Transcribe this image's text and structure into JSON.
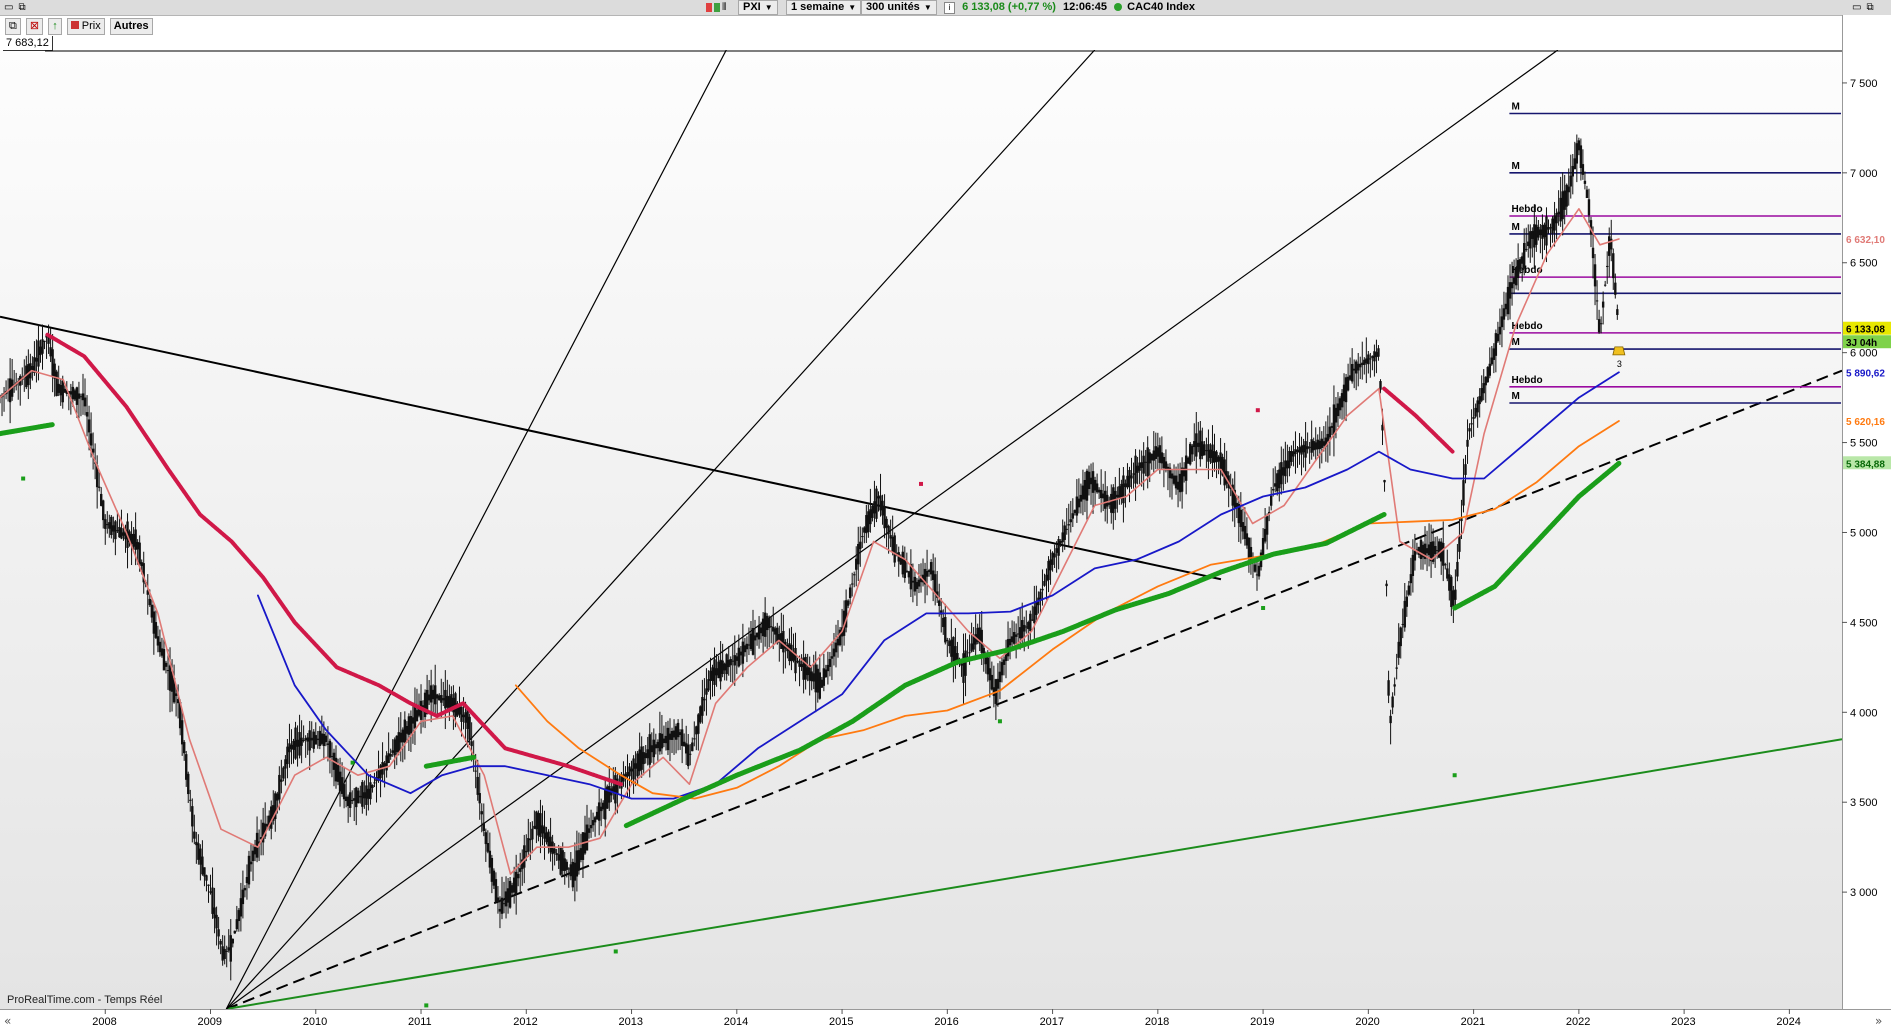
{
  "topbar": {
    "symbol": "PXI",
    "period": "1 semaine",
    "units": "300 unités",
    "quote": "6 133,08 (+0,77 %)",
    "time": "12:06:45",
    "instrument": "CAC40 Index"
  },
  "toolbar": {
    "price_tab": "Prix",
    "others_tab": "Autres"
  },
  "max_label": "7 683,12",
  "watermark": "ProRealTime.com - Temps Réel",
  "colors": {
    "candles": "#111111",
    "ma_fast": "#e07a76",
    "ma_blue": "#1818c8",
    "ma_orange": "#ff7a10",
    "ma_green": "#1a9e1a",
    "ma_red": "#d01848",
    "level_navy": "#16166e",
    "level_purple": "#9a0aa0"
  },
  "chart_data": {
    "type": "candlestick",
    "title": "",
    "xlabel": "",
    "ylabel": "",
    "x_ticks": [
      "2008",
      "2009",
      "2010",
      "2011",
      "2012",
      "2013",
      "2014",
      "2015",
      "2016",
      "2017",
      "2018",
      "2019",
      "2020",
      "2021",
      "2022",
      "2023",
      "2024"
    ],
    "y_ticks": [
      "7 500",
      "7 000",
      "6 500",
      "6 000",
      "5 500",
      "5 000",
      "4 500",
      "4 000",
      "3 500",
      "3 000"
    ],
    "xlim": [
      2007.0,
      2024.5
    ],
    "ylim": [
      2350,
      7683.12
    ],
    "price_path": [
      [
        2007.0,
        5750
      ],
      [
        2007.3,
        5900
      ],
      [
        2007.45,
        6100
      ],
      [
        2007.55,
        5800
      ],
      [
        2007.8,
        5750
      ],
      [
        2008.0,
        5050
      ],
      [
        2008.3,
        4950
      ],
      [
        2008.5,
        4400
      ],
      [
        2008.7,
        4050
      ],
      [
        2008.85,
        3300
      ],
      [
        2009.0,
        3000
      ],
      [
        2009.12,
        2650
      ],
      [
        2009.2,
        2700
      ],
      [
        2009.4,
        3200
      ],
      [
        2009.6,
        3450
      ],
      [
        2009.75,
        3800
      ],
      [
        2009.9,
        3850
      ],
      [
        2010.1,
        3850
      ],
      [
        2010.3,
        3500
      ],
      [
        2010.5,
        3550
      ],
      [
        2010.8,
        3850
      ],
      [
        2011.1,
        4100
      ],
      [
        2011.3,
        4050
      ],
      [
        2011.45,
        3950
      ],
      [
        2011.6,
        3350
      ],
      [
        2011.75,
        2900
      ],
      [
        2011.9,
        3050
      ],
      [
        2012.1,
        3400
      ],
      [
        2012.3,
        3200
      ],
      [
        2012.45,
        3100
      ],
      [
        2012.6,
        3350
      ],
      [
        2012.8,
        3550
      ],
      [
        2012.95,
        3650
      ],
      [
        2013.2,
        3800
      ],
      [
        2013.45,
        3900
      ],
      [
        2013.55,
        3750
      ],
      [
        2013.75,
        4200
      ],
      [
        2014.0,
        4300
      ],
      [
        2014.3,
        4500
      ],
      [
        2014.55,
        4300
      ],
      [
        2014.8,
        4150
      ],
      [
        2015.0,
        4450
      ],
      [
        2015.2,
        5000
      ],
      [
        2015.35,
        5200
      ],
      [
        2015.5,
        4900
      ],
      [
        2015.7,
        4700
      ],
      [
        2015.85,
        4800
      ],
      [
        2016.0,
        4400
      ],
      [
        2016.15,
        4250
      ],
      [
        2016.3,
        4450
      ],
      [
        2016.45,
        4100
      ],
      [
        2016.6,
        4400
      ],
      [
        2016.8,
        4500
      ],
      [
        2017.0,
        4850
      ],
      [
        2017.2,
        5100
      ],
      [
        2017.35,
        5300
      ],
      [
        2017.55,
        5150
      ],
      [
        2017.8,
        5350
      ],
      [
        2018.0,
        5450
      ],
      [
        2018.2,
        5250
      ],
      [
        2018.35,
        5500
      ],
      [
        2018.6,
        5400
      ],
      [
        2018.75,
        5150
      ],
      [
        2018.95,
        4750
      ],
      [
        2019.1,
        5250
      ],
      [
        2019.3,
        5450
      ],
      [
        2019.6,
        5500
      ],
      [
        2019.85,
        5900
      ],
      [
        2020.1,
        6000
      ],
      [
        2020.15,
        5400
      ],
      [
        2020.2,
        3900
      ],
      [
        2020.3,
        4400
      ],
      [
        2020.45,
        4900
      ],
      [
        2020.7,
        4900
      ],
      [
        2020.82,
        4600
      ],
      [
        2020.95,
        5550
      ],
      [
        2021.15,
        5900
      ],
      [
        2021.35,
        6350
      ],
      [
        2021.55,
        6650
      ],
      [
        2021.75,
        6700
      ],
      [
        2021.9,
        6900
      ],
      [
        2022.0,
        7150
      ],
      [
        2022.1,
        6800
      ],
      [
        2022.2,
        6100
      ],
      [
        2022.3,
        6650
      ],
      [
        2022.38,
        6133.08
      ]
    ],
    "series": [
      {
        "name": "",
        "color_key": "ma_fast",
        "points": [
          [
            2007.0,
            5750
          ],
          [
            2007.3,
            5900
          ],
          [
            2007.6,
            5850
          ],
          [
            2007.9,
            5400
          ],
          [
            2008.2,
            5000
          ],
          [
            2008.5,
            4550
          ],
          [
            2008.8,
            3850
          ],
          [
            2009.1,
            3350
          ],
          [
            2009.45,
            3250
          ],
          [
            2009.8,
            3650
          ],
          [
            2010.1,
            3750
          ],
          [
            2010.4,
            3650
          ],
          [
            2010.7,
            3700
          ],
          [
            2011.0,
            3950
          ],
          [
            2011.3,
            3980
          ],
          [
            2011.6,
            3650
          ],
          [
            2011.85,
            3100
          ],
          [
            2012.1,
            3250
          ],
          [
            2012.4,
            3250
          ],
          [
            2012.7,
            3300
          ],
          [
            2013.0,
            3600
          ],
          [
            2013.3,
            3750
          ],
          [
            2013.55,
            3600
          ],
          [
            2013.8,
            4050
          ],
          [
            2014.1,
            4250
          ],
          [
            2014.4,
            4400
          ],
          [
            2014.7,
            4250
          ],
          [
            2015.0,
            4450
          ],
          [
            2015.3,
            4950
          ],
          [
            2015.6,
            4850
          ],
          [
            2015.9,
            4650
          ],
          [
            2016.2,
            4450
          ],
          [
            2016.5,
            4300
          ],
          [
            2016.8,
            4450
          ],
          [
            2017.1,
            4800
          ],
          [
            2017.4,
            5150
          ],
          [
            2017.7,
            5200
          ],
          [
            2018.0,
            5350
          ],
          [
            2018.3,
            5350
          ],
          [
            2018.6,
            5350
          ],
          [
            2018.9,
            5050
          ],
          [
            2019.2,
            5150
          ],
          [
            2019.5,
            5400
          ],
          [
            2019.8,
            5650
          ],
          [
            2020.1,
            5800
          ],
          [
            2020.3,
            4950
          ],
          [
            2020.6,
            4850
          ],
          [
            2020.9,
            5000
          ],
          [
            2021.1,
            5550
          ],
          [
            2021.4,
            6150
          ],
          [
            2021.7,
            6550
          ],
          [
            2022.0,
            6800
          ],
          [
            2022.2,
            6600
          ],
          [
            2022.38,
            6632.1
          ]
        ]
      },
      {
        "name": "",
        "color_key": "ma_blue",
        "points": [
          [
            2009.45,
            4650
          ],
          [
            2009.8,
            4150
          ],
          [
            2010.1,
            3900
          ],
          [
            2010.5,
            3650
          ],
          [
            2010.9,
            3550
          ],
          [
            2011.2,
            3650
          ],
          [
            2011.5,
            3700
          ],
          [
            2011.8,
            3700
          ],
          [
            2012.2,
            3650
          ],
          [
            2012.6,
            3600
          ],
          [
            2013.0,
            3520
          ],
          [
            2013.4,
            3520
          ],
          [
            2013.8,
            3600
          ],
          [
            2014.2,
            3800
          ],
          [
            2014.6,
            3950
          ],
          [
            2015.0,
            4100
          ],
          [
            2015.4,
            4400
          ],
          [
            2015.8,
            4550
          ],
          [
            2016.2,
            4550
          ],
          [
            2016.6,
            4560
          ],
          [
            2017.0,
            4650
          ],
          [
            2017.4,
            4800
          ],
          [
            2017.8,
            4850
          ],
          [
            2018.2,
            4950
          ],
          [
            2018.6,
            5100
          ],
          [
            2019.0,
            5200
          ],
          [
            2019.4,
            5250
          ],
          [
            2019.8,
            5350
          ],
          [
            2020.1,
            5450
          ],
          [
            2020.4,
            5350
          ],
          [
            2020.8,
            5300
          ],
          [
            2021.1,
            5300
          ],
          [
            2021.4,
            5450
          ],
          [
            2021.7,
            5600
          ],
          [
            2022.0,
            5750
          ],
          [
            2022.38,
            5890.62
          ]
        ]
      },
      {
        "name": "",
        "color_key": "ma_orange",
        "points": [
          [
            2011.9,
            4150
          ],
          [
            2012.2,
            3950
          ],
          [
            2012.5,
            3800
          ],
          [
            2012.9,
            3650
          ],
          [
            2013.2,
            3550
          ],
          [
            2013.6,
            3520
          ],
          [
            2014.0,
            3580
          ],
          [
            2014.4,
            3700
          ],
          [
            2014.8,
            3850
          ],
          [
            2015.2,
            3900
          ],
          [
            2015.6,
            3980
          ],
          [
            2016.0,
            4010
          ],
          [
            2016.5,
            4120
          ],
          [
            2017.0,
            4350
          ],
          [
            2017.5,
            4550
          ],
          [
            2018.0,
            4700
          ],
          [
            2018.5,
            4820
          ],
          [
            2019.0,
            4870
          ],
          [
            2019.5,
            4930
          ],
          [
            2020.0,
            5050
          ],
          [
            2020.4,
            5060
          ],
          [
            2020.8,
            5070
          ],
          [
            2021.2,
            5130
          ],
          [
            2021.6,
            5280
          ],
          [
            2022.0,
            5480
          ],
          [
            2022.38,
            5620.16
          ]
        ]
      },
      {
        "name": "",
        "color_key": "ma_green",
        "points": [
          [
            2007.0,
            5550
          ],
          [
            2007.5,
            5600
          ]
        ]
      },
      {
        "name": "",
        "color_key": "ma_green",
        "points": [
          [
            2011.05,
            3700
          ],
          [
            2011.5,
            3750
          ]
        ]
      },
      {
        "name": "",
        "color_key": "ma_green",
        "points": [
          [
            2012.95,
            3370
          ],
          [
            2013.5,
            3520
          ],
          [
            2014.0,
            3650
          ],
          [
            2014.6,
            3790
          ],
          [
            2015.1,
            3950
          ],
          [
            2015.6,
            4150
          ],
          [
            2016.1,
            4280
          ],
          [
            2016.6,
            4350
          ],
          [
            2017.1,
            4450
          ],
          [
            2017.6,
            4570
          ],
          [
            2018.1,
            4660
          ],
          [
            2018.6,
            4780
          ],
          [
            2019.1,
            4880
          ],
          [
            2019.6,
            4940
          ],
          [
            2020.15,
            5100
          ]
        ]
      },
      {
        "name": "",
        "color_key": "ma_green",
        "points": [
          [
            2020.82,
            4580
          ],
          [
            2021.2,
            4700
          ],
          [
            2021.6,
            4950
          ],
          [
            2022.0,
            5200
          ],
          [
            2022.38,
            5384.88
          ]
        ]
      },
      {
        "name": "",
        "color_key": "ma_red",
        "points": [
          [
            2007.45,
            6100
          ],
          [
            2007.8,
            5980
          ],
          [
            2008.2,
            5700
          ],
          [
            2008.6,
            5350
          ],
          [
            2008.9,
            5100
          ],
          [
            2009.2,
            4950
          ],
          [
            2009.5,
            4750
          ],
          [
            2009.8,
            4500
          ],
          [
            2010.2,
            4250
          ],
          [
            2010.6,
            4150
          ],
          [
            2010.9,
            4050
          ],
          [
            2011.15,
            3980
          ],
          [
            2011.4,
            4050
          ],
          [
            2011.8,
            3800
          ],
          [
            2012.4,
            3700
          ],
          [
            2012.9,
            3600
          ]
        ]
      },
      {
        "name": "",
        "color_key": "ma_red",
        "points": [
          [
            2020.15,
            5800
          ],
          [
            2020.45,
            5650
          ],
          [
            2020.8,
            5450
          ]
        ]
      }
    ],
    "levels": [
      {
        "label": "M",
        "value": 7330,
        "color_key": "level_navy"
      },
      {
        "label": "M",
        "value": 7000,
        "color_key": "level_navy"
      },
      {
        "label": "Hebdo",
        "value": 6760,
        "color_key": "level_purple"
      },
      {
        "label": "M",
        "value": 6660,
        "color_key": "level_navy"
      },
      {
        "label": "Hebdo",
        "value": 6420,
        "color_key": "level_purple"
      },
      {
        "label": "",
        "value": 6330,
        "color_key": "level_navy"
      },
      {
        "label": "Hebdo",
        "value": 6110,
        "color_key": "level_purple"
      },
      {
        "label": "M",
        "value": 6020,
        "color_key": "level_navy"
      },
      {
        "label": "Hebdo",
        "value": 5810,
        "color_key": "level_purple"
      },
      {
        "label": "M",
        "value": 5720,
        "color_key": "level_navy"
      }
    ],
    "trendlines": [
      {
        "from": [
          2007.0,
          6200
        ],
        "to": [
          2018.6,
          4740
        ],
        "color": "#000000",
        "dash": false
      },
      {
        "from": [
          2009.15,
          2350
        ],
        "to": [
          2024.5,
          5900
        ],
        "color": "#000000",
        "dash": true
      },
      {
        "from": [
          2009.15,
          2350
        ],
        "to": [
          2024.5,
          3850
        ],
        "color": "#1c8c1c",
        "dash": false
      },
      {
        "from": [
          2009.15,
          2350
        ],
        "to": [
          2013.9,
          7683.12
        ],
        "color": "#000000",
        "dash": false
      },
      {
        "from": [
          2009.15,
          2350
        ],
        "to": [
          2017.4,
          7683.12
        ],
        "color": "#000000",
        "dash": false
      },
      {
        "from": [
          2009.15,
          2350
        ],
        "to": [
          2021.8,
          7683.12
        ],
        "color": "#000000",
        "dash": false
      }
    ],
    "price_tags": [
      {
        "text": "6 632,10",
        "value": 6632.1,
        "bg": "#ffffff",
        "fg": "#e07a76"
      },
      {
        "text": "6 133,08",
        "value": 6133.08,
        "bg": "#e8e800",
        "fg": "#000000"
      },
      {
        "text": "3J 04h",
        "value": 6058,
        "bg": "#7fd24a",
        "fg": "#000000"
      },
      {
        "text": "5 890,62",
        "value": 5890.62,
        "bg": "#ffffff",
        "fg": "#1818c8"
      },
      {
        "text": "5 620,16",
        "value": 5620.16,
        "bg": "#ffffff",
        "fg": "#ff7a10"
      },
      {
        "text": "5 384,88",
        "value": 5384.88,
        "bg": "#b9e7a8",
        "fg": "#0a6a0a"
      }
    ],
    "dot_markers": [
      {
        "x": 2007.22,
        "y": 5300,
        "color": "#1a9e1a"
      },
      {
        "x": 2010.35,
        "y": 3720,
        "color": "#1a9e1a"
      },
      {
        "x": 2012.85,
        "y": 2670,
        "color": "#1a9e1a"
      },
      {
        "x": 2011.05,
        "y": 2370,
        "color": "#1a9e1a"
      },
      {
        "x": 2016.5,
        "y": 3950,
        "color": "#1a9e1a"
      },
      {
        "x": 2015.75,
        "y": 5270,
        "color": "#d01848"
      },
      {
        "x": 2018.95,
        "y": 5680,
        "color": "#d01848"
      },
      {
        "x": 2020.82,
        "y": 3650,
        "color": "#1a9e1a"
      },
      {
        "x": 2019.0,
        "y": 4580,
        "color": "#1a9e1a"
      }
    ],
    "alert_marker": {
      "x": 2022.38,
      "y": 6010,
      "label": "3"
    }
  }
}
